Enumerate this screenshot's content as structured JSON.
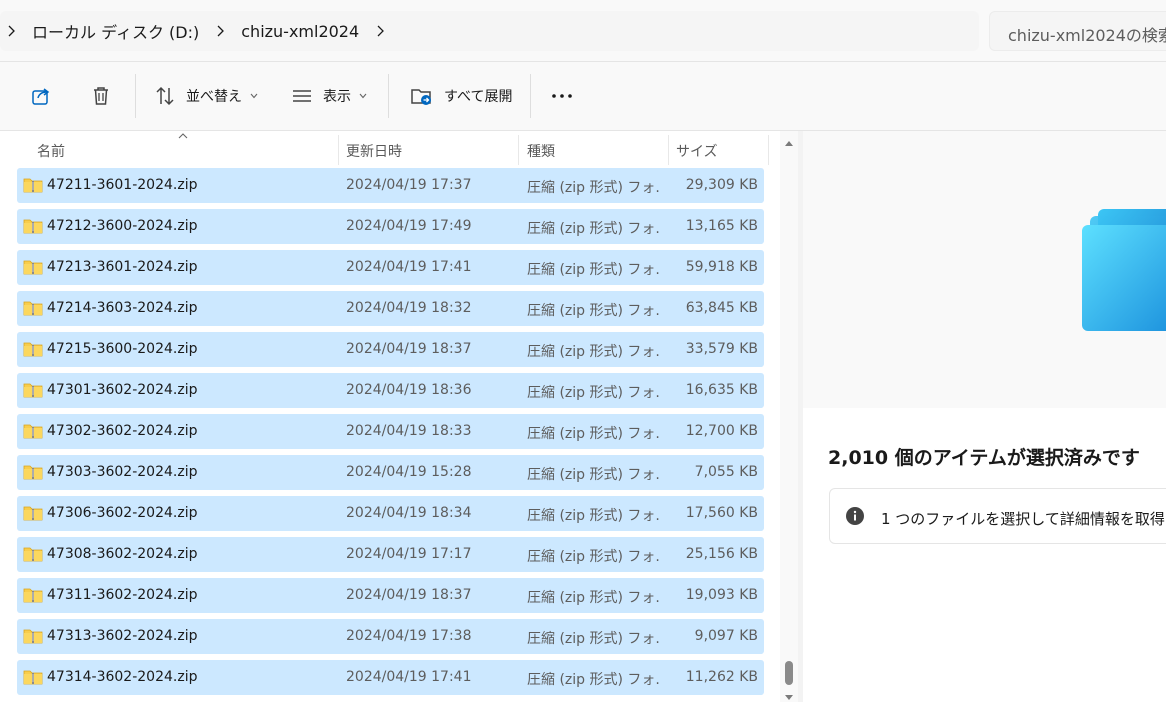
{
  "address": {
    "crumbs": [
      "ローカル ディスク (D:)",
      "chizu-xml2024"
    ],
    "search_placeholder": "chizu-xml2024の検索"
  },
  "toolbar": {
    "share_icon": "share-icon",
    "delete_icon": "trash-icon",
    "sort_label": "並べ替え",
    "view_label": "表示",
    "expand_label": "すべて展開",
    "more_label": "..."
  },
  "columns": {
    "name": "名前",
    "date": "更新日時",
    "type": "種類",
    "size": "サイズ"
  },
  "files": [
    {
      "name": "47211-3601-2024.zip",
      "date": "2024/04/19 17:37",
      "type": "圧縮 (zip 形式) フォ...",
      "size": "29,309 KB"
    },
    {
      "name": "47212-3600-2024.zip",
      "date": "2024/04/19 17:49",
      "type": "圧縮 (zip 形式) フォ...",
      "size": "13,165 KB"
    },
    {
      "name": "47213-3601-2024.zip",
      "date": "2024/04/19 17:41",
      "type": "圧縮 (zip 形式) フォ...",
      "size": "59,918 KB"
    },
    {
      "name": "47214-3603-2024.zip",
      "date": "2024/04/19 18:32",
      "type": "圧縮 (zip 形式) フォ...",
      "size": "63,845 KB"
    },
    {
      "name": "47215-3600-2024.zip",
      "date": "2024/04/19 18:37",
      "type": "圧縮 (zip 形式) フォ...",
      "size": "33,579 KB"
    },
    {
      "name": "47301-3602-2024.zip",
      "date": "2024/04/19 18:36",
      "type": "圧縮 (zip 形式) フォ...",
      "size": "16,635 KB"
    },
    {
      "name": "47302-3602-2024.zip",
      "date": "2024/04/19 18:33",
      "type": "圧縮 (zip 形式) フォ...",
      "size": "12,700 KB"
    },
    {
      "name": "47303-3602-2024.zip",
      "date": "2024/04/19 15:28",
      "type": "圧縮 (zip 形式) フォ...",
      "size": "7,055 KB"
    },
    {
      "name": "47306-3602-2024.zip",
      "date": "2024/04/19 18:34",
      "type": "圧縮 (zip 形式) フォ...",
      "size": "17,560 KB"
    },
    {
      "name": "47308-3602-2024.zip",
      "date": "2024/04/19 17:17",
      "type": "圧縮 (zip 形式) フォ...",
      "size": "25,156 KB"
    },
    {
      "name": "47311-3602-2024.zip",
      "date": "2024/04/19 18:37",
      "type": "圧縮 (zip 形式) フォ...",
      "size": "19,093 KB"
    },
    {
      "name": "47313-3602-2024.zip",
      "date": "2024/04/19 17:38",
      "type": "圧縮 (zip 形式) フォ...",
      "size": "9,097 KB"
    },
    {
      "name": "47314-3602-2024.zip",
      "date": "2024/04/19 17:41",
      "type": "圧縮 (zip 形式) フォ...",
      "size": "11,262 KB"
    }
  ],
  "details": {
    "selection_title": "2,010 個のアイテムが選択済みです",
    "info_text": "1 つのファイルを選択して詳細情報を取得し"
  },
  "colors": {
    "selection": "#cce8ff",
    "folder_front": "#2fb4ec",
    "accent": "#0067c0"
  }
}
